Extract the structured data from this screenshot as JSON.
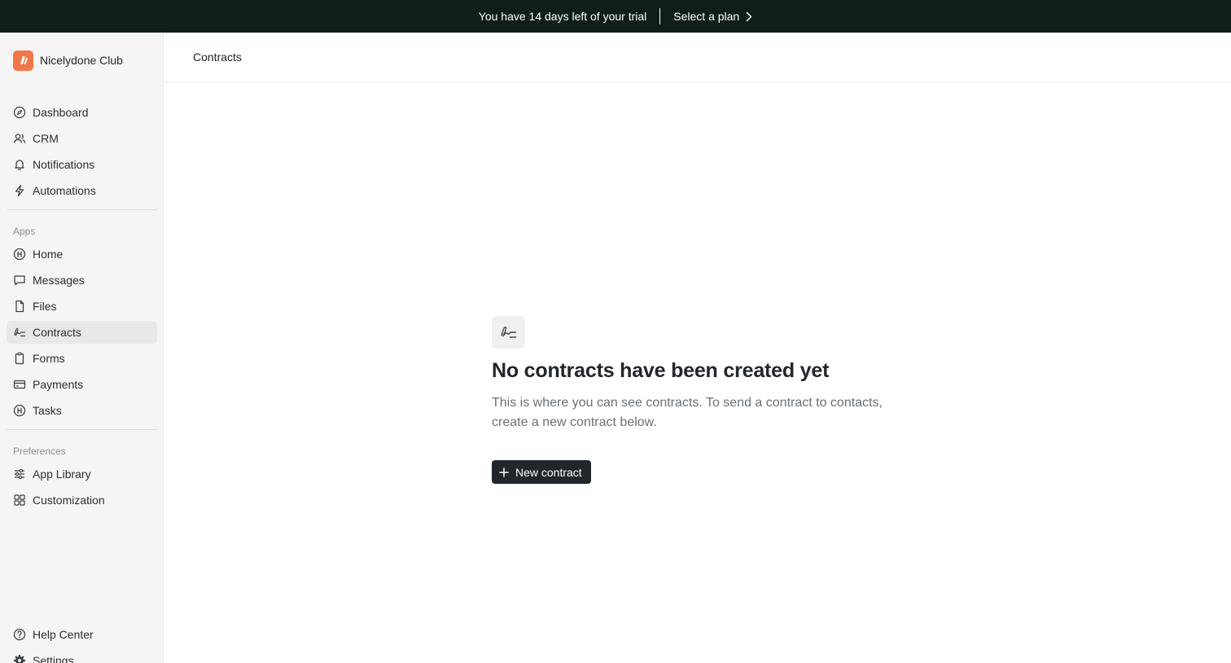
{
  "banner": {
    "message": "You have 14 days left of your trial",
    "cta": "Select a plan"
  },
  "workspace": {
    "name": "Nicelydone Club",
    "accent": "#f2764a"
  },
  "sidebar": {
    "main": [
      {
        "label": "Dashboard",
        "icon": "compass-icon"
      },
      {
        "label": "CRM",
        "icon": "users-icon"
      },
      {
        "label": "Notifications",
        "icon": "bell-icon"
      },
      {
        "label": "Automations",
        "icon": "lightning-icon"
      }
    ],
    "apps_label": "Apps",
    "apps": [
      {
        "label": "Home",
        "icon": "home-app-icon"
      },
      {
        "label": "Messages",
        "icon": "chat-icon"
      },
      {
        "label": "Files",
        "icon": "file-icon"
      },
      {
        "label": "Contracts",
        "icon": "signature-icon",
        "active": true
      },
      {
        "label": "Forms",
        "icon": "clipboard-icon"
      },
      {
        "label": "Payments",
        "icon": "credit-card-icon"
      },
      {
        "label": "Tasks",
        "icon": "tasks-icon"
      }
    ],
    "preferences_label": "Preferences",
    "preferences": [
      {
        "label": "App Library",
        "icon": "sliders-icon"
      },
      {
        "label": "Customization",
        "icon": "grid-icon"
      }
    ],
    "footer": [
      {
        "label": "Help Center",
        "icon": "help-icon"
      },
      {
        "label": "Settings",
        "icon": "gear-icon"
      }
    ]
  },
  "header": {
    "title": "Contracts"
  },
  "empty_state": {
    "title": "No contracts have been created yet",
    "description": "This is where you can see contracts. To send a contract to contacts, create a new contract below.",
    "button_label": "New contract"
  }
}
